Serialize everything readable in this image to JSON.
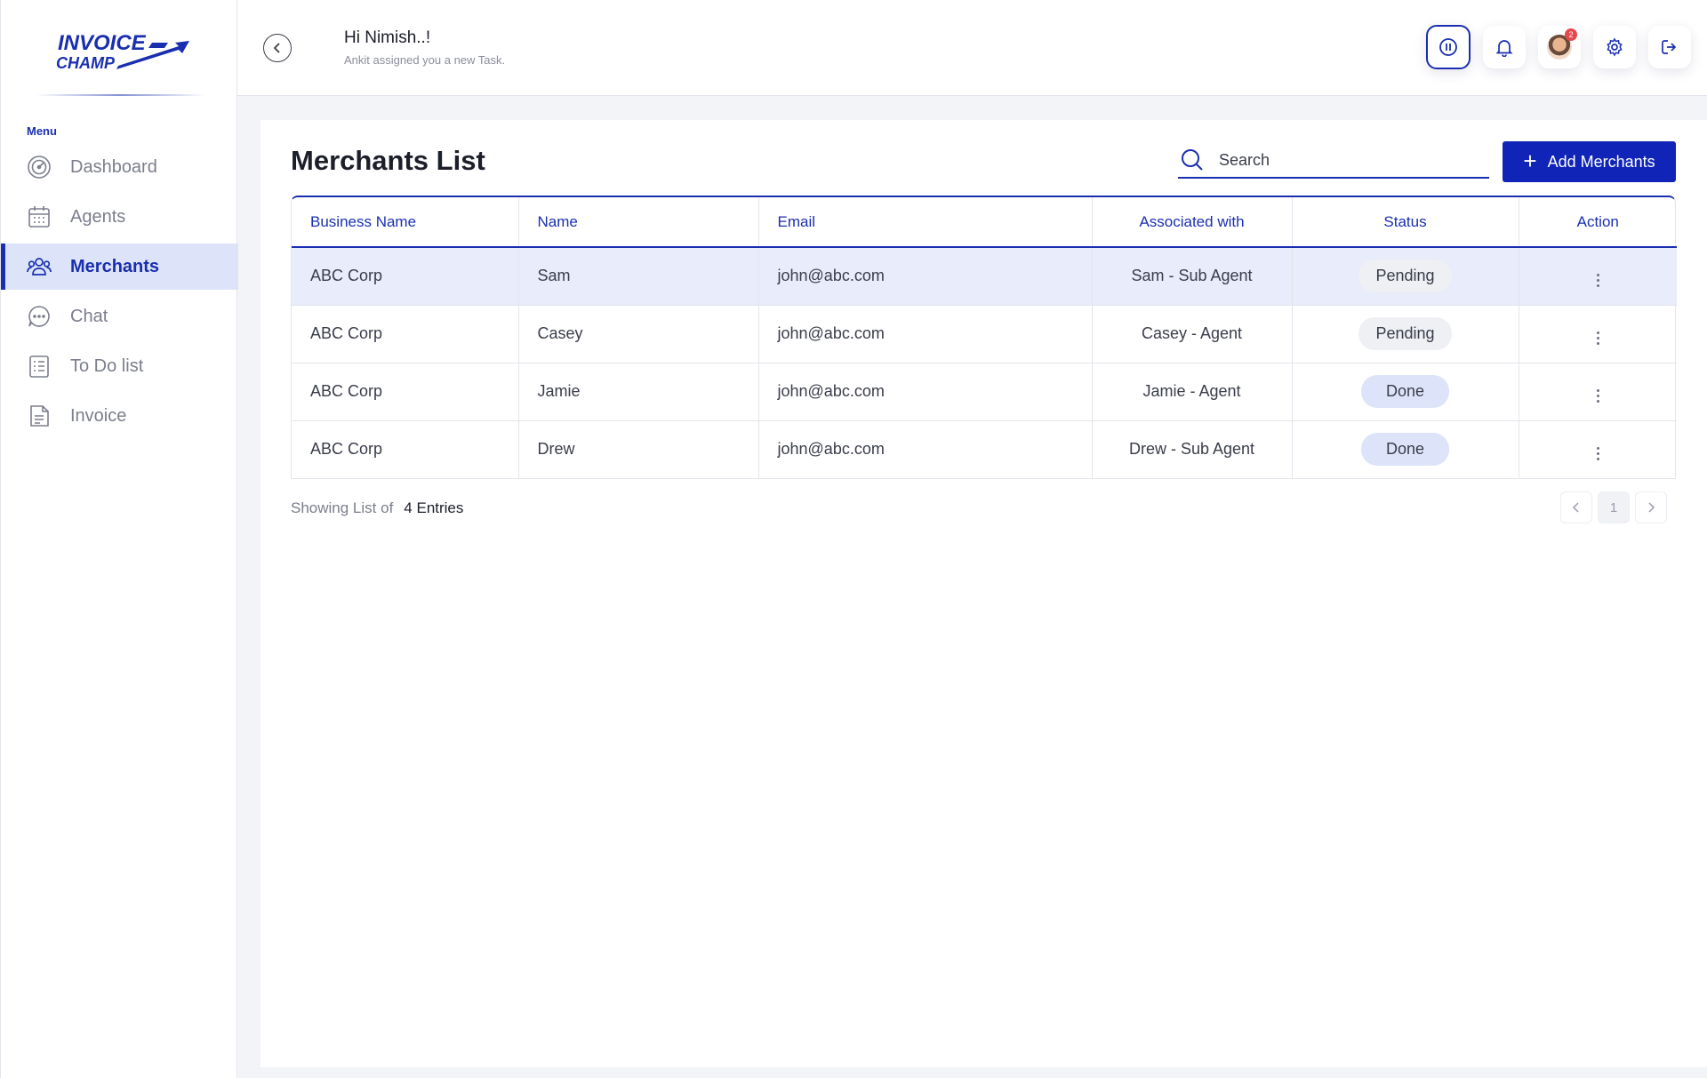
{
  "brand": {
    "line1": "INVOICE",
    "line2": "CHAMP"
  },
  "sidebar": {
    "menu_label": "Menu",
    "items": [
      {
        "label": "Dashboard",
        "icon": "dashboard-gauge-icon"
      },
      {
        "label": "Agents",
        "icon": "calendar-icon"
      },
      {
        "label": "Merchants",
        "icon": "users-icon",
        "active": true
      },
      {
        "label": "Chat",
        "icon": "chat-bubble-icon"
      },
      {
        "label": "To Do list",
        "icon": "checklist-icon"
      },
      {
        "label": "Invoice",
        "icon": "document-icon"
      }
    ]
  },
  "header": {
    "greeting": "Hi Nimish..!",
    "subtext": "Ankit assigned you a new Task.",
    "notification_count": "2"
  },
  "page": {
    "title": "Merchants List",
    "search_placeholder": "Search",
    "add_button": "Add Merchants"
  },
  "table": {
    "columns": [
      "Business Name",
      "Name",
      "Email",
      "Associated with",
      "Status",
      "Action"
    ],
    "rows": [
      {
        "business": "ABC Corp",
        "name": "Sam",
        "email": "john@abc.com",
        "associated": "Sam  - Sub Agent",
        "status": "Pending"
      },
      {
        "business": "ABC Corp",
        "name": "Casey",
        "email": "john@abc.com",
        "associated": "Casey - Agent",
        "status": "Pending"
      },
      {
        "business": "ABC Corp",
        "name": "Jamie",
        "email": "john@abc.com",
        "associated": "Jamie - Agent",
        "status": "Done"
      },
      {
        "business": "ABC Corp",
        "name": "Drew",
        "email": "john@abc.com",
        "associated": "Drew - Sub Agent",
        "status": "Done"
      }
    ]
  },
  "footer": {
    "showing_label": "Showing List of",
    "entries": "4 Entries",
    "current_page": "1",
    "prev_icon": "chevron-left-icon",
    "next_icon": "chevron-right-icon"
  },
  "colors": {
    "primary": "#1024b8",
    "accent": "#1a2fb0",
    "active_bg": "#dde4fa"
  }
}
